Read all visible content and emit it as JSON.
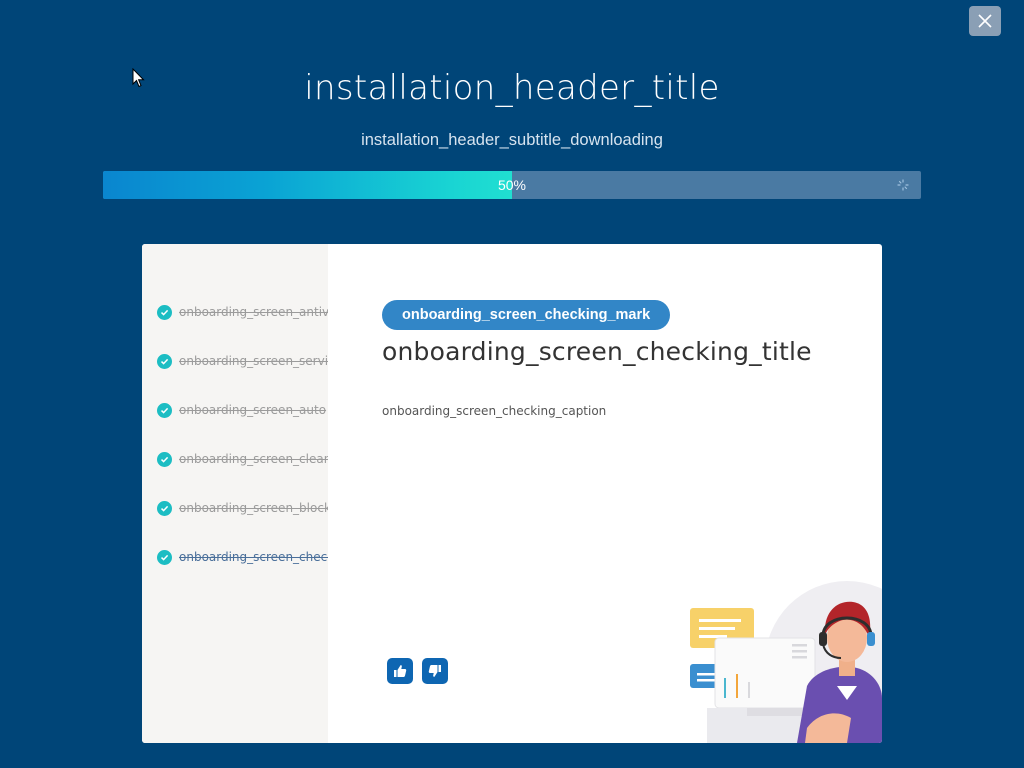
{
  "window": {
    "close_label": "close"
  },
  "header": {
    "title": "installation_header_title",
    "subtitle": "installation_header_subtitle_downloading"
  },
  "progress": {
    "value_percent": 50,
    "label": "50%"
  },
  "onboarding": {
    "steps": [
      {
        "label": "onboarding_screen_antivirus",
        "done": true
      },
      {
        "label": "onboarding_screen_service",
        "done": true
      },
      {
        "label": "onboarding_screen_auto",
        "done": true
      },
      {
        "label": "onboarding_screen_cleaner",
        "done": true
      },
      {
        "label": "onboarding_screen_blocker",
        "done": true
      },
      {
        "label": "onboarding_screen_checking",
        "done": true,
        "active": true
      }
    ],
    "mark": "onboarding_screen_checking_mark",
    "title": "onboarding_screen_checking_title",
    "caption": "onboarding_screen_checking_caption",
    "feedback": {
      "like_icon": "thumbs-up-icon",
      "dislike_icon": "thumbs-down-icon"
    }
  },
  "colors": {
    "background": "#004578",
    "accent": "#3286c7",
    "check": "#1cbdc3",
    "progress_track": "#4a7aa3"
  }
}
